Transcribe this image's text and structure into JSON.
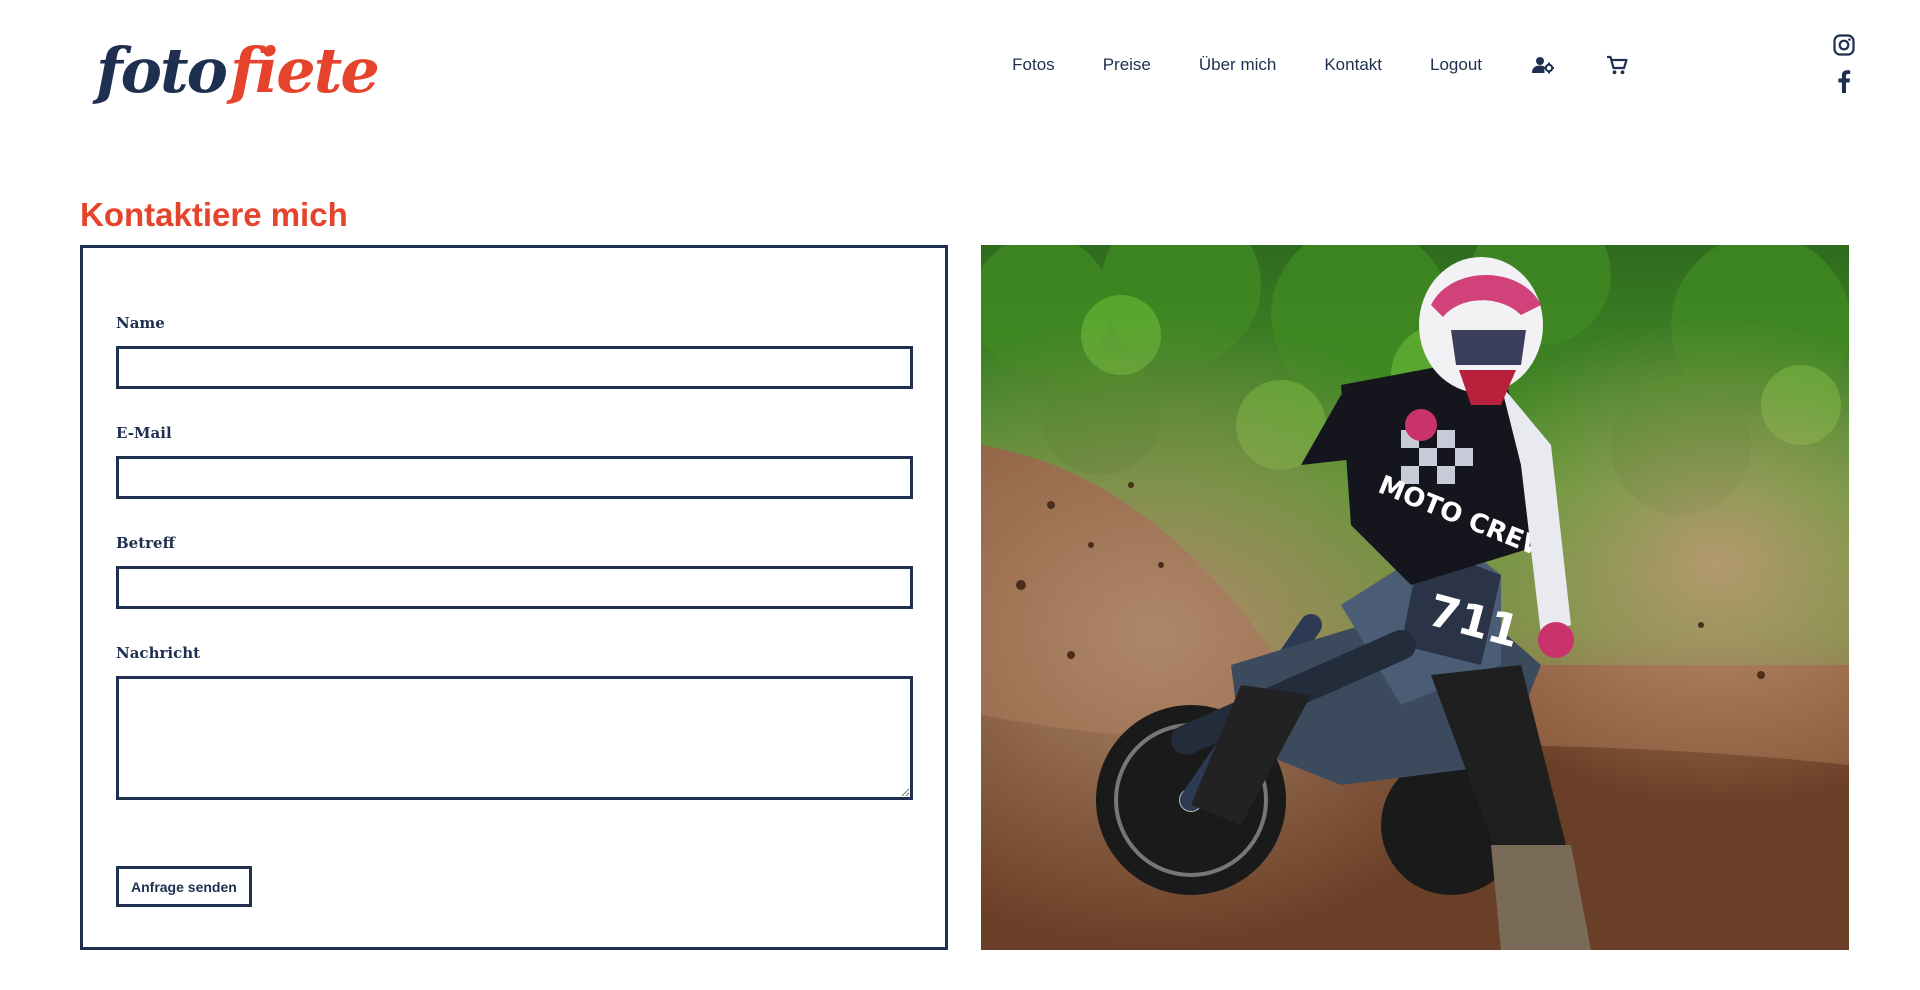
{
  "brand": {
    "logo_part1": "foto",
    "logo_part2": "fiete"
  },
  "nav": {
    "items": [
      {
        "label": "Fotos"
      },
      {
        "label": "Preise"
      },
      {
        "label": "Über mich"
      },
      {
        "label": "Kontakt"
      },
      {
        "label": "Logout"
      }
    ],
    "icons": [
      "user-settings-icon",
      "cart-icon"
    ]
  },
  "social": {
    "icons": [
      "instagram-icon",
      "facebook-icon"
    ]
  },
  "page": {
    "title": "Kontaktiere mich"
  },
  "form": {
    "name_label": "Name",
    "name_value": "",
    "email_label": "E-Mail",
    "email_value": "",
    "subject_label": "Betreff",
    "subject_value": "",
    "message_label": "Nachricht",
    "message_value": "",
    "submit_label": "Anfrage senden"
  },
  "photo": {
    "icon": "motocross-photo",
    "bike_number": "711",
    "jersey_text": "MOTO CREW"
  },
  "colors": {
    "navy": "#1e2f4f",
    "accent": "#e5432c"
  }
}
